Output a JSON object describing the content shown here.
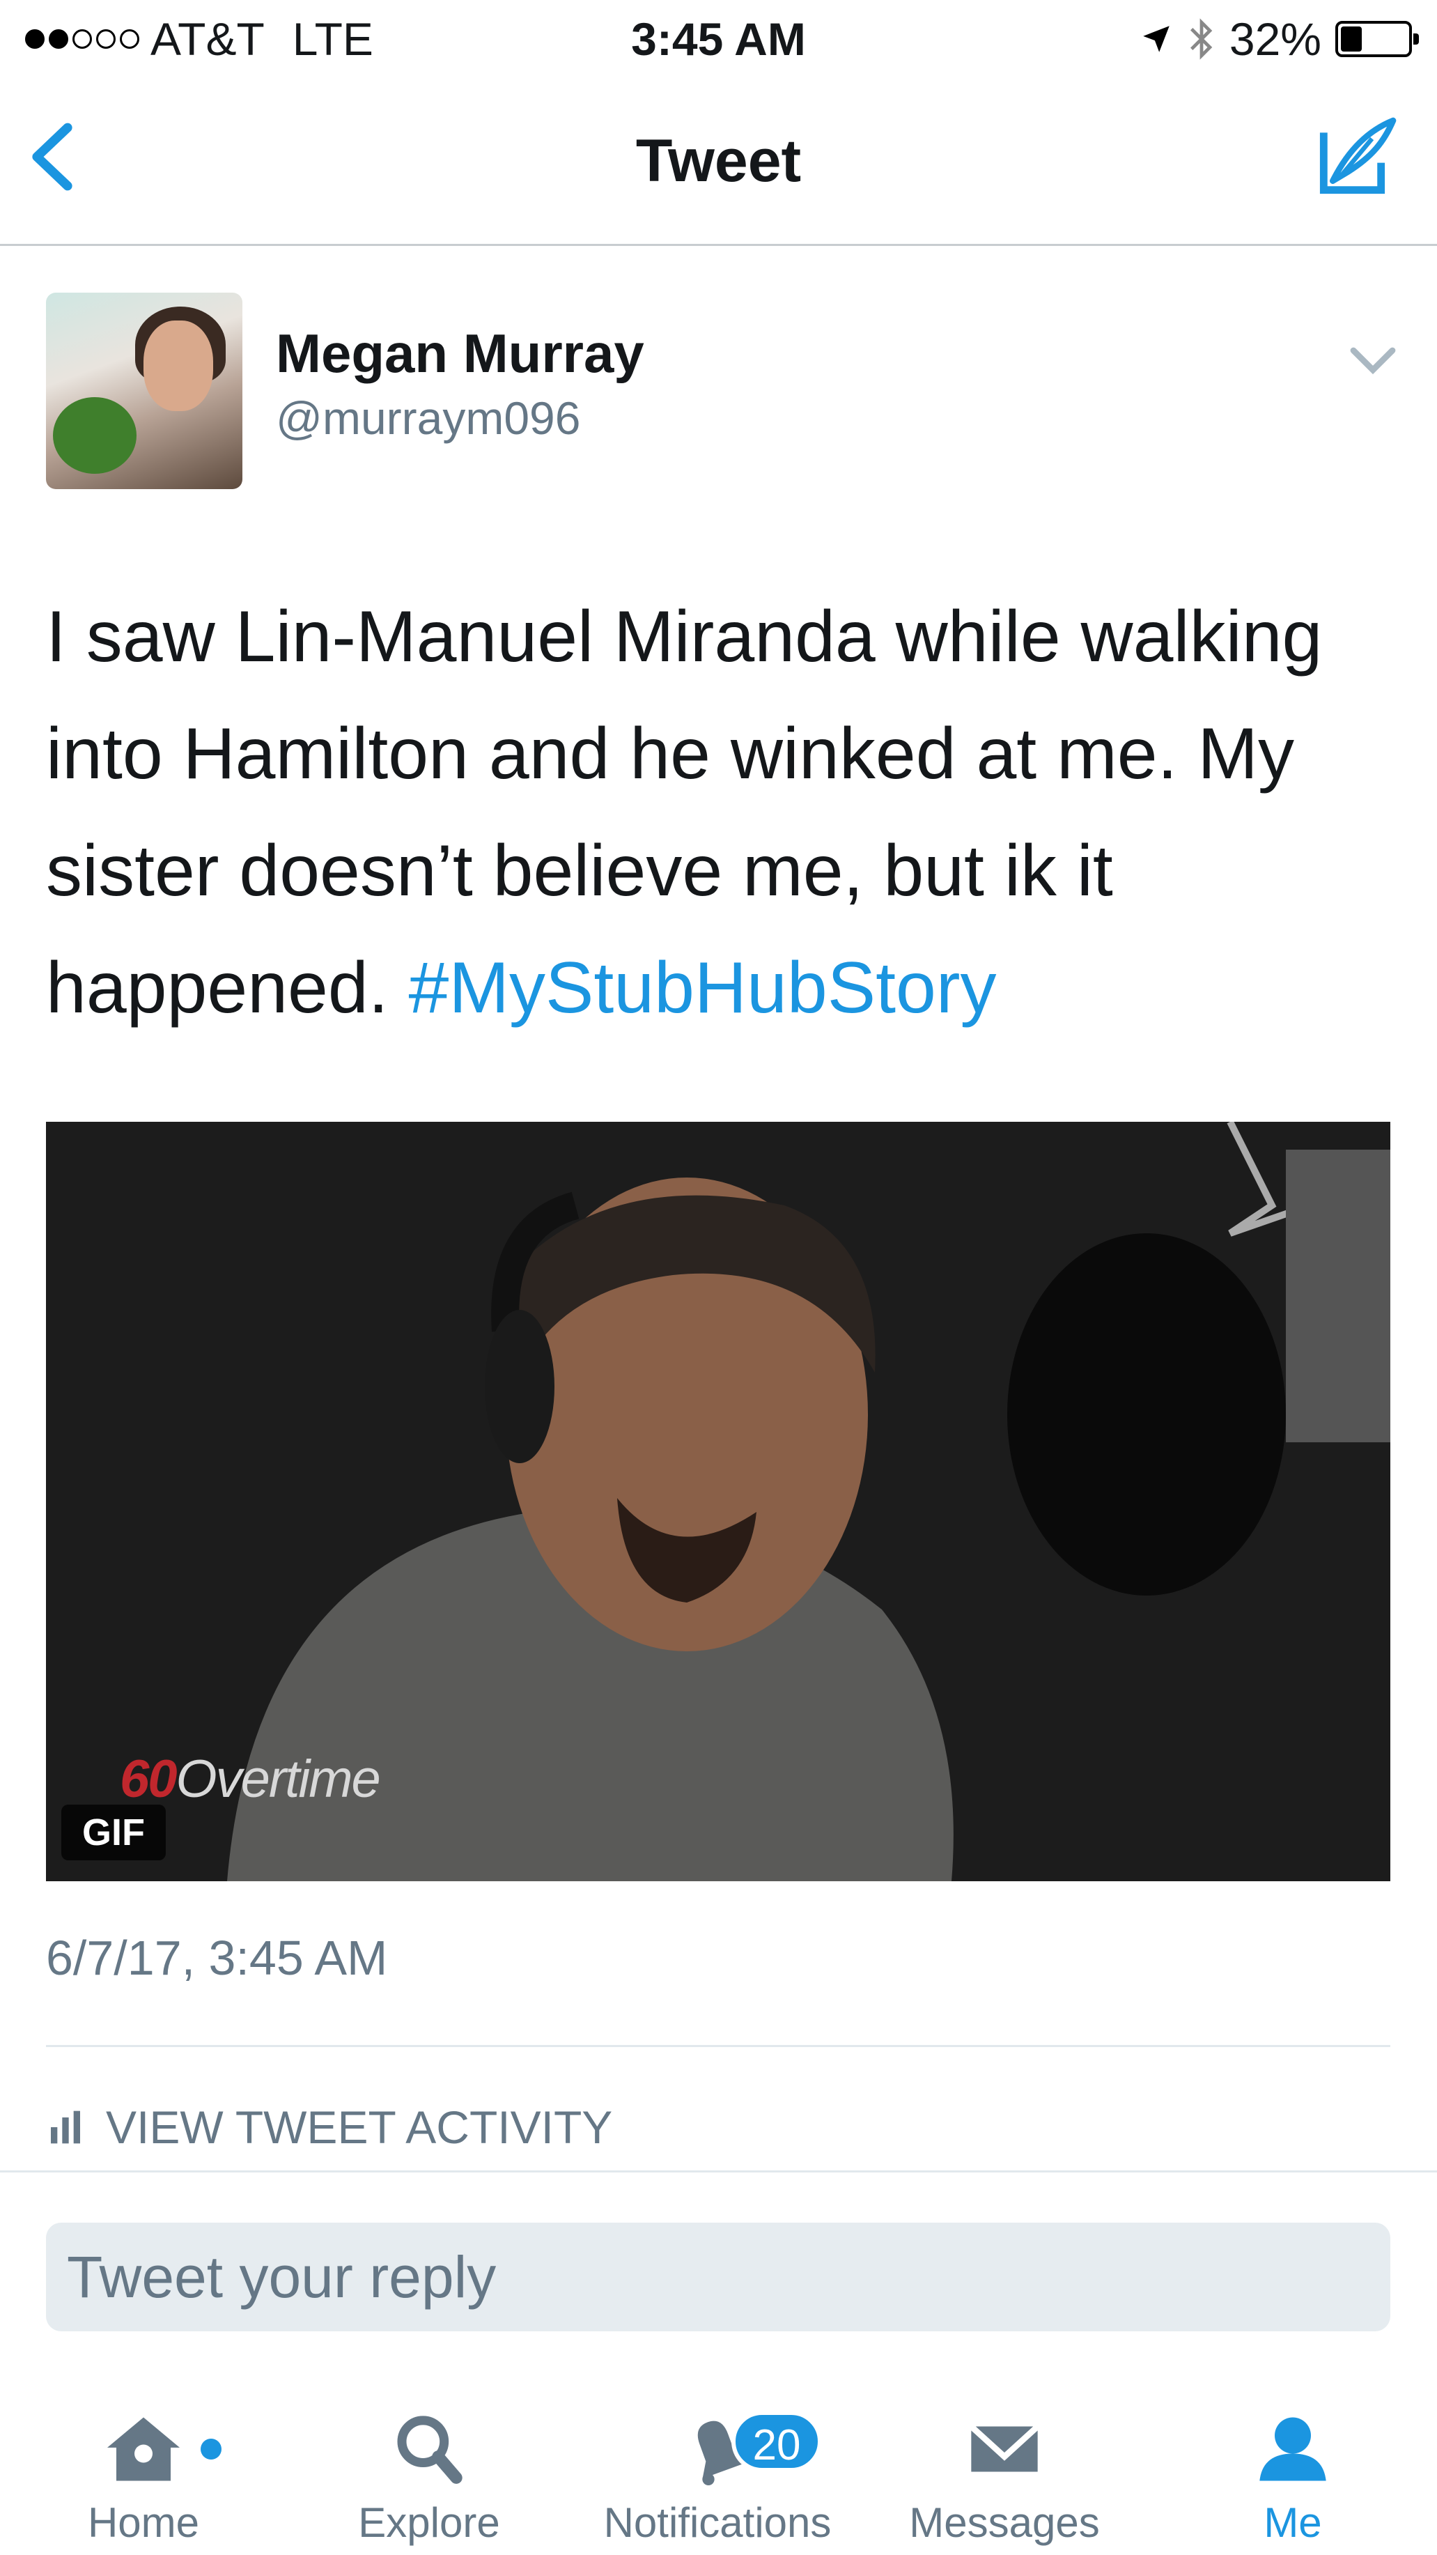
{
  "status_bar": {
    "carrier": "AT&T",
    "network": "LTE",
    "time": "3:45 AM",
    "battery": "32%",
    "battery_level": 0.32
  },
  "nav": {
    "title": "Tweet"
  },
  "tweet": {
    "author_name": "Megan Murray",
    "author_handle": "@murraym096",
    "text": "I saw Lin-Manuel Miranda while walking into Hamilton and he winked at me. My sister doesn’t believe me, but ik it happened. ",
    "hashtag": "#MyStubHubStory",
    "media_badge": "GIF",
    "media_brand_num": "60",
    "media_brand_text": "Overtime",
    "timestamp": "6/7/17, 3:45 AM"
  },
  "activity_label": "VIEW TWEET ACTIVITY",
  "reply_placeholder": "Tweet your reply",
  "tabs": [
    {
      "label": "Home",
      "icon": "home-icon"
    },
    {
      "label": "Explore",
      "icon": "search-icon"
    },
    {
      "label": "Notifications",
      "icon": "bell-icon",
      "badge": "20"
    },
    {
      "label": "Messages",
      "icon": "envelope-icon"
    },
    {
      "label": "Me",
      "icon": "person-icon"
    }
  ],
  "colors": {
    "accent": "#1b95e0",
    "text": "#14171a",
    "secondary": "#657786"
  }
}
